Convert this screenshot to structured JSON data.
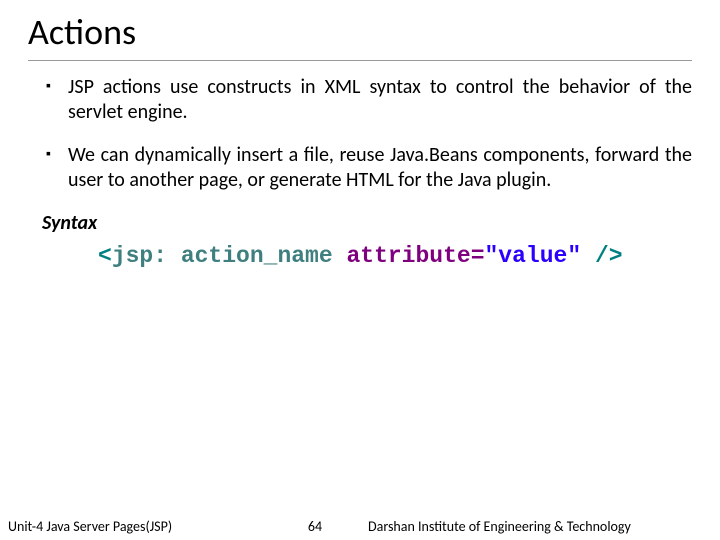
{
  "title": "Actions",
  "bullets": [
    "JSP actions use constructs in XML syntax to control the behavior of the servlet engine.",
    "We can dynamically insert a file, reuse Java.Beans components, forward the user to another page, or generate HTML for the Java plugin."
  ],
  "syntax_label": "Syntax",
  "code": {
    "open": "<",
    "tag": "jsp: action_name",
    "space1": " ",
    "attr": "attribute=",
    "val": "\"value\"",
    "space2": " ",
    "close": "/>"
  },
  "footer": {
    "unit": "Unit-4 Java Server Pages(JSP)",
    "page": "64",
    "institute": "Darshan Institute of Engineering & Technology"
  }
}
